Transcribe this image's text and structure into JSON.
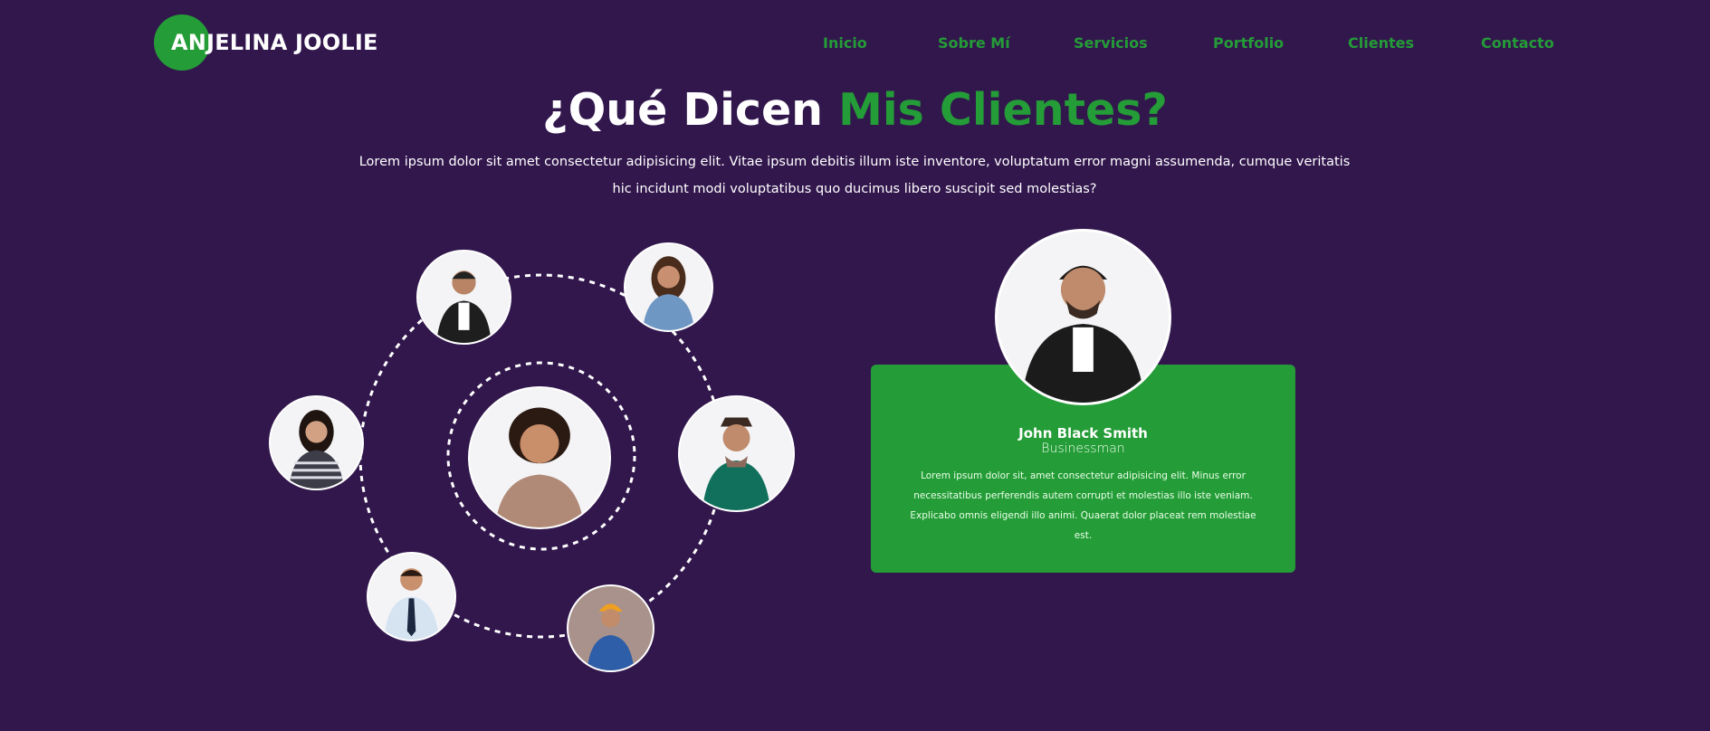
{
  "brand": {
    "name": "ANJELINA JOOLIE",
    "accent": "#249c37",
    "background": "#32174d"
  },
  "nav": [
    {
      "label": "Inicio"
    },
    {
      "label": "Sobre Mí"
    },
    {
      "label": "Servicios"
    },
    {
      "label": "Portfolio"
    },
    {
      "label": "Clientes"
    },
    {
      "label": "Contacto"
    }
  ],
  "section": {
    "title_main": "¿Qué Dicen ",
    "title_accent": "Mis Clientes?",
    "intro": "Lorem ipsum dolor sit amet consectetur adipisicing elit. Vitae ipsum debitis illum iste inventore, voluptatum error magni assumenda, cumque veritatis hic incidunt modi voluptatibus quo ducimus libero suscipit sed molestias?"
  },
  "testimonial": {
    "name": "John Black Smith",
    "role": "Businessman",
    "text": "Lorem ipsum dolor sit, amet consectetur adipisicing elit. Minus error necessitatibus perferendis autem corrupti et molestias illo iste veniam. Explicabo omnis eligendi illo animi. Quaerat dolor placeat rem molestiae est."
  },
  "clients": [
    {
      "icon": "client-avatar-icon"
    },
    {
      "icon": "client-avatar-icon"
    },
    {
      "icon": "client-avatar-icon"
    },
    {
      "icon": "client-avatar-icon"
    },
    {
      "icon": "client-avatar-icon"
    },
    {
      "icon": "client-avatar-icon"
    },
    {
      "icon": "client-avatar-icon"
    }
  ]
}
